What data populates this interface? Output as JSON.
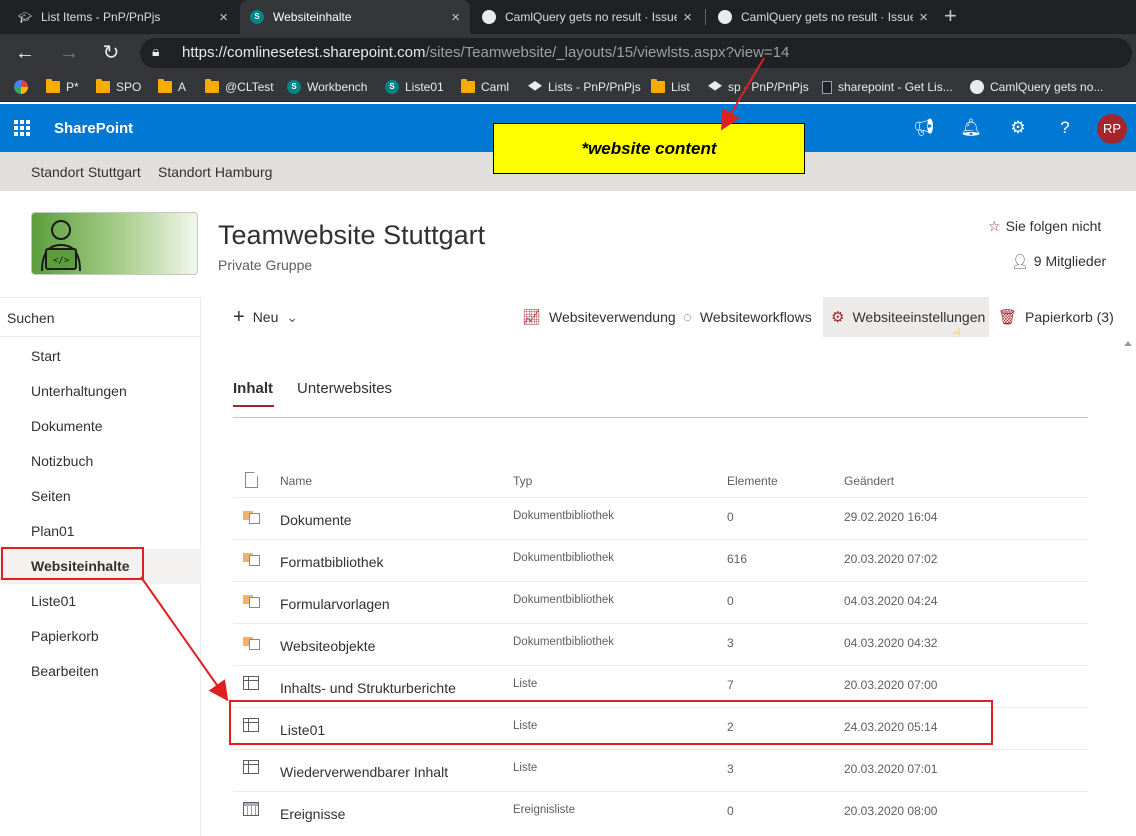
{
  "browser": {
    "tabs": [
      {
        "title": "List Items - PnP/PnPjs",
        "icon": "graduation-cap-icon",
        "active": false
      },
      {
        "title": "Websiteinhalte",
        "icon": "sharepoint-icon",
        "active": true
      },
      {
        "title": "CamlQuery gets no result · Issue",
        "icon": "github-icon",
        "active": false
      },
      {
        "title": "CamlQuery gets no result · Issue",
        "icon": "github-icon",
        "active": false
      }
    ],
    "close_glyph": "×",
    "new_tab_glyph": "+",
    "url_host": "https://comlinesetest.sharepoint.com",
    "url_path": "/sites/Teamwebsite/_layouts/15/viewlsts.aspx?view=14",
    "bookmarks": [
      {
        "label": "",
        "icon": "google-icon"
      },
      {
        "label": "P*",
        "icon": "folder-icon"
      },
      {
        "label": "SPO",
        "icon": "folder-icon"
      },
      {
        "label": "A",
        "icon": "folder-icon"
      },
      {
        "label": "@CLTest",
        "icon": "folder-icon"
      },
      {
        "label": "Workbench",
        "icon": "sharepoint-icon"
      },
      {
        "label": "Liste01",
        "icon": "sharepoint-icon"
      },
      {
        "label": "Caml",
        "icon": "folder-icon"
      },
      {
        "label": "Lists - PnP/PnPjs",
        "icon": "graduation-cap-icon"
      },
      {
        "label": "List",
        "icon": "folder-icon"
      },
      {
        "label": "sp - PnP/PnPjs",
        "icon": "graduation-cap-icon"
      },
      {
        "label": "sharepoint - Get Lis...",
        "icon": "page-icon"
      },
      {
        "label": "CamlQuery gets no...",
        "icon": "github-icon"
      }
    ]
  },
  "suite": {
    "brand": "SharePoint",
    "avatar_initials": "RP"
  },
  "hub_nav": [
    "Standort Stuttgart",
    "Standort Hamburg"
  ],
  "site": {
    "title": "Teamwebsite Stuttgart",
    "subtitle": "Private Gruppe",
    "follow": "Sie folgen nicht",
    "members": "9 Mitglieder"
  },
  "left_nav": {
    "search": "Suchen",
    "items": [
      "Start",
      "Unterhaltungen",
      "Dokumente",
      "Notizbuch",
      "Seiten",
      "Plan01",
      "Websiteinhalte",
      "Liste01",
      "Papierkorb",
      "Bearbeiten"
    ],
    "selected": "Websiteinhalte"
  },
  "command_bar": {
    "new": "Neu",
    "usage": "Websiteverwendung",
    "workflows": "Websiteworkflows",
    "settings": "Websiteeinstellungen",
    "recycle": "Papierkorb (3)"
  },
  "pivots": {
    "content": "Inhalt",
    "subsites": "Unterwebsites"
  },
  "table": {
    "headers": {
      "name": "Name",
      "type": "Typ",
      "items": "Elemente",
      "modified": "Geändert"
    },
    "rows": [
      {
        "name": "Dokumente",
        "type": "Dokumentbibliothek",
        "items": "0",
        "modified": "29.02.2020 16:04",
        "icon": "library-icon"
      },
      {
        "name": "Formatbibliothek",
        "type": "Dokumentbibliothek",
        "items": "616",
        "modified": "20.03.2020 07:02",
        "icon": "library-icon"
      },
      {
        "name": "Formularvorlagen",
        "type": "Dokumentbibliothek",
        "items": "0",
        "modified": "04.03.2020 04:24",
        "icon": "library-icon"
      },
      {
        "name": "Websiteobjekte",
        "type": "Dokumentbibliothek",
        "items": "3",
        "modified": "04.03.2020 04:32",
        "icon": "library-icon"
      },
      {
        "name": "Inhalts- und Strukturberichte",
        "type": "Liste",
        "items": "7",
        "modified": "20.03.2020 07:00",
        "icon": "list-icon"
      },
      {
        "name": "Liste01",
        "type": "Liste",
        "items": "2",
        "modified": "24.03.2020 05:14",
        "icon": "list-icon"
      },
      {
        "name": "Wiederverwendbarer Inhalt",
        "type": "Liste",
        "items": "3",
        "modified": "20.03.2020 07:01",
        "icon": "list-icon"
      },
      {
        "name": "Ereignisse",
        "type": "Ereignisliste",
        "items": "0",
        "modified": "20.03.2020 08:00",
        "icon": "calendar-icon"
      }
    ]
  },
  "annotation": {
    "callout_text": "*website content",
    "color": "#e02020",
    "callout_color": "#ffff00"
  }
}
